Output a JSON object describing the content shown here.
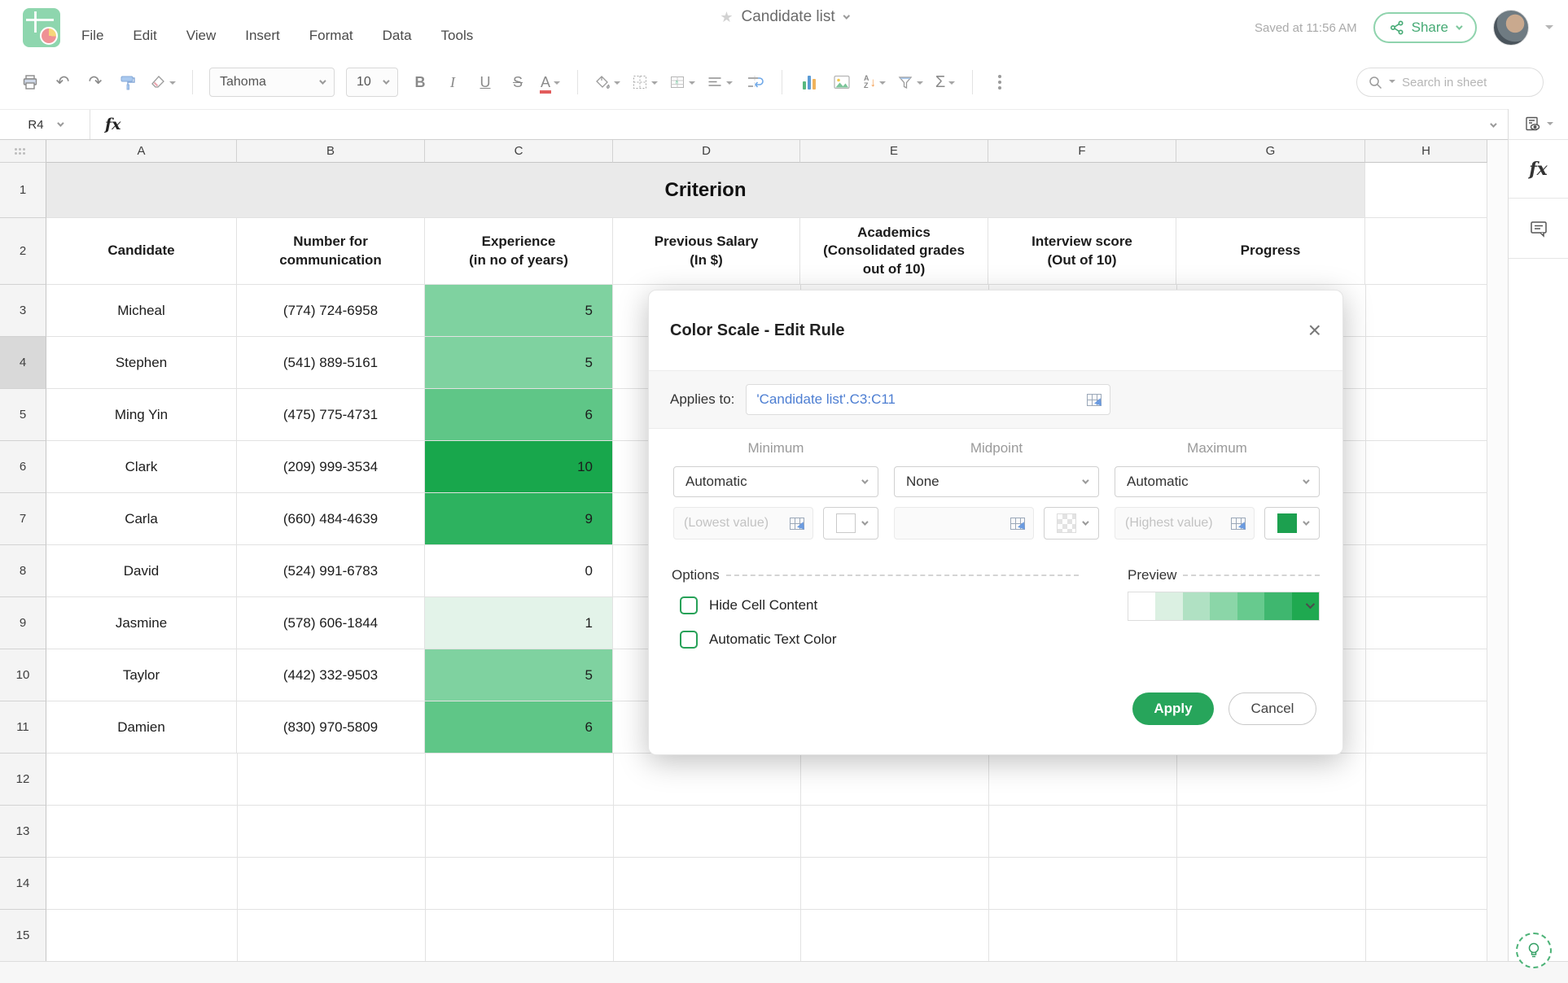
{
  "top_bar": {
    "menu_items": [
      "File",
      "Edit",
      "View",
      "Insert",
      "Format",
      "Data",
      "Tools"
    ],
    "document_title": "Candidate list",
    "saved_status": "Saved at 11:56 AM",
    "share_label": "Share"
  },
  "toolbar": {
    "font_family": "Tahoma",
    "font_size": "10",
    "bold_label": "B",
    "italic_label": "I",
    "underline_label": "U",
    "strikethrough_label": "S",
    "font_color_label": "A",
    "sum_label": "Σ",
    "sort_label_top": "A",
    "sort_label_bottom": "Z",
    "sort_arrow": "↓",
    "undo_glyph": "↶",
    "redo_glyph": "↷",
    "search_placeholder": "Search in sheet"
  },
  "formula_bar": {
    "name_box_value": "R4",
    "fx_label": "fx",
    "formula_value": ""
  },
  "sheet": {
    "column_letters": [
      "A",
      "B",
      "C",
      "D",
      "E",
      "F",
      "G",
      "H"
    ],
    "row_numbers": [
      "1",
      "2",
      "3",
      "4",
      "5",
      "6",
      "7",
      "8",
      "9",
      "10",
      "11",
      "12",
      "13",
      "14",
      "15"
    ],
    "title_cell": "Criterion",
    "column_headers": [
      "Candidate",
      "Number for\ncommunication",
      "Experience\n(in no of years)",
      "Previous Salary\n(In $)",
      "Academics\n(Consolidated grades\nout of 10)",
      "Interview score\n(Out of 10)",
      "Progress"
    ],
    "candidates": [
      {
        "name": "Micheal",
        "phone": "(774) 724-6958",
        "experience": "5",
        "color": "#7fd2a0"
      },
      {
        "name": "Stephen",
        "phone": "(541) 889-5161",
        "experience": "5",
        "color": "#7fd2a0"
      },
      {
        "name": "Ming Yin",
        "phone": "(475) 775-4731",
        "experience": "6",
        "color": "#5fc687"
      },
      {
        "name": "Clark",
        "phone": "(209) 999-3534",
        "experience": "10",
        "color": "#18a74c"
      },
      {
        "name": "Carla",
        "phone": "(660) 484-4639",
        "experience": "9",
        "color": "#2db25f"
      },
      {
        "name": "David",
        "phone": "(524) 991-6783",
        "experience": "0",
        "color": "#ffffff"
      },
      {
        "name": "Jasmine",
        "phone": "(578) 606-1844",
        "experience": "1",
        "color": "#e3f3e9"
      },
      {
        "name": "Taylor",
        "phone": "(442) 332-9503",
        "experience": "5",
        "color": "#7fd2a0"
      },
      {
        "name": "Damien",
        "phone": "(830) 970-5809",
        "experience": "6",
        "color": "#5fc687"
      }
    ]
  },
  "dialog": {
    "title": "Color Scale - Edit Rule",
    "applies_to_label": "Applies to:",
    "applies_to_value": "'Candidate list'.C3:C11",
    "minimum": {
      "label": "Minimum",
      "value": "Automatic",
      "placeholder": "(Lowest value)",
      "swatch": "#ffffff"
    },
    "midpoint": {
      "label": "Midpoint",
      "value": "None",
      "placeholder": ""
    },
    "maximum": {
      "label": "Maximum",
      "value": "Automatic",
      "placeholder": "(Highest value)",
      "swatch": "#1ca04f"
    },
    "options_label": "Options",
    "option_hide_cell_content": "Hide Cell Content",
    "option_automatic_text_color": "Automatic Text Color",
    "preview_label": "Preview",
    "preview_colors": [
      "#ffffff",
      "#dbf0e2",
      "#b0e1c3",
      "#8bd6a8",
      "#67ca8e",
      "#3fb76f",
      "#1fa950"
    ],
    "apply_label": "Apply",
    "cancel_label": "Cancel"
  }
}
